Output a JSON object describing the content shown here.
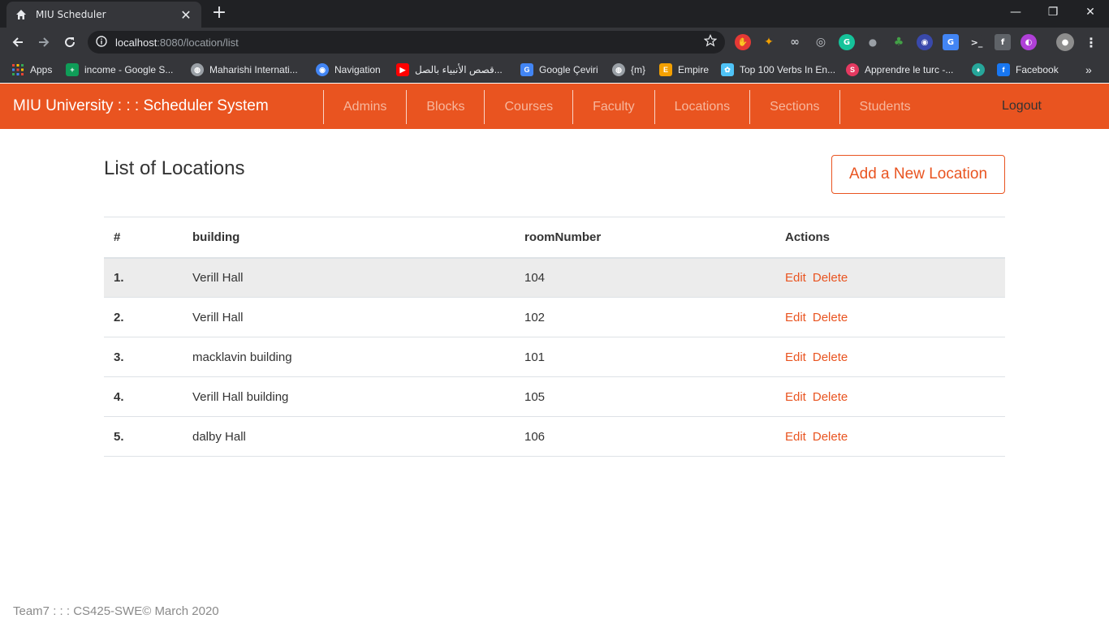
{
  "browser": {
    "tab_title": "MIU Scheduler",
    "url_host": "localhost",
    "url_rest": ":8080/location/list",
    "bookmarks": [
      {
        "label": "Apps",
        "icon": "apps-grid-icon",
        "color": "#ea4335"
      },
      {
        "label": "income - Google S...",
        "icon": "sheets-icon",
        "color": "#0f9d58"
      },
      {
        "label": "Maharishi Internati...",
        "icon": "globe-icon",
        "color": "#9aa0a6"
      },
      {
        "label": "Navigation",
        "icon": "navigation-icon",
        "color": "#4285f4"
      },
      {
        "label": "قصص الأنبياء بالصل...",
        "icon": "youtube-icon",
        "color": "#ff0000"
      },
      {
        "label": "Google Çeviri",
        "icon": "translate-icon",
        "color": "#4285f4"
      },
      {
        "label": "{m}",
        "icon": "globe-icon",
        "color": "#9aa0a6"
      },
      {
        "label": "Empire",
        "icon": "empire-icon",
        "color": "#f4a000"
      },
      {
        "label": "Top 100 Verbs In En...",
        "icon": "puzzle-icon",
        "color": "#4fc3f7"
      },
      {
        "label": "Apprendre le turc -...",
        "icon": "s-icon",
        "color": "#e53960"
      },
      {
        "label": "",
        "icon": "leaf-icon",
        "color": "#26a69a"
      },
      {
        "label": "Facebook",
        "icon": "facebook-icon",
        "color": "#1877f2"
      }
    ],
    "more_bookmarks": "»"
  },
  "app": {
    "brand": "MIU University : : : Scheduler System",
    "nav": [
      "Admins",
      "Blocks",
      "Courses",
      "Faculty",
      "Locations",
      "Sections",
      "Students"
    ],
    "logout": "Logout",
    "accent_color": "#e95420"
  },
  "main": {
    "title": "List of Locations",
    "add_button": "Add a New Location",
    "columns": [
      "#",
      "building",
      "roomNumber",
      "Actions"
    ],
    "rows": [
      {
        "num": "1.",
        "building": "Verill Hall",
        "room": "104",
        "edit": "Edit",
        "delete": "Delete"
      },
      {
        "num": "2.",
        "building": "Verill Hall",
        "room": "102",
        "edit": "Edit",
        "delete": "Delete"
      },
      {
        "num": "3.",
        "building": "macklavin building",
        "room": "101",
        "edit": "Edit",
        "delete": "Delete"
      },
      {
        "num": "4.",
        "building": "Verill Hall building",
        "room": "105",
        "edit": "Edit",
        "delete": "Delete"
      },
      {
        "num": "5.",
        "building": "dalby Hall",
        "room": "106",
        "edit": "Edit",
        "delete": "Delete"
      }
    ]
  },
  "footer": {
    "text": "Team7 : : : CS425-SWE© March 2020"
  }
}
